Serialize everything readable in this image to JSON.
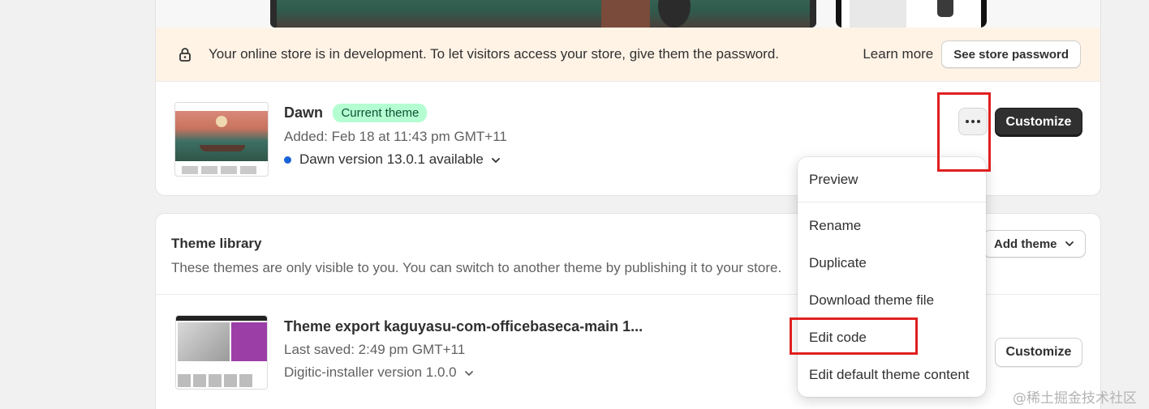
{
  "banner": {
    "icon": "lock-icon",
    "message": "Your online store is in development. To let visitors access your store, give them the password.",
    "learn_more": "Learn more",
    "password_button": "See store password"
  },
  "current_theme": {
    "name": "Dawn",
    "badge": "Current theme",
    "added": "Added: Feb 18 at 11:43 pm GMT+11",
    "version": "Dawn version 13.0.1 available",
    "version_dot_color": "#1a63d6",
    "customize_label": "Customize"
  },
  "actions_menu": {
    "items": [
      "Preview",
      "Rename",
      "Duplicate",
      "Download theme file",
      "Edit code",
      "Edit default theme content"
    ]
  },
  "library": {
    "title": "Theme library",
    "subtitle": "These themes are only visible to you. You can switch to another theme by publishing it to your store.",
    "add_theme": "Add theme",
    "themes": [
      {
        "name": "Theme export kaguyasu-com-officebaseca-main 1...",
        "saved": "Last saved: 2:49 pm GMT+11",
        "version": "Digitic-installer version 1.0.0",
        "customize_label": "Customize"
      }
    ]
  },
  "annotations": {
    "color": "#e01f1f"
  },
  "watermark": "@稀土掘金技术社区"
}
